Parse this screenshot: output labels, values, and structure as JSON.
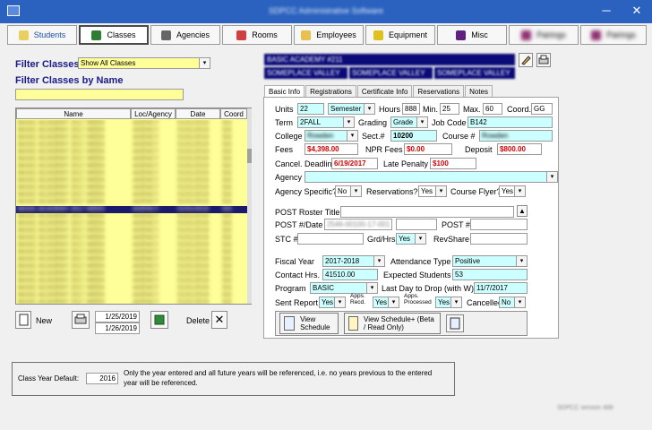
{
  "window": {
    "title": "SDPCC Administrative Software",
    "minimize": "─",
    "close": "✕"
  },
  "topnav": [
    {
      "label": "Students",
      "icon": "student-icon"
    },
    {
      "label": "Classes",
      "icon": "classes-icon"
    },
    {
      "label": "Agencies",
      "icon": "agencies-icon"
    },
    {
      "label": "Rooms",
      "icon": "rooms-icon"
    },
    {
      "label": "Employees",
      "icon": "employees-icon"
    },
    {
      "label": "Equipment",
      "icon": "equipment-icon"
    },
    {
      "label": "Misc",
      "icon": "misc-icon"
    },
    {
      "label": "Pairings",
      "icon": "pairings-icon"
    },
    {
      "label": "Pairings",
      "icon": "pairings-icon"
    }
  ],
  "filter": {
    "label": "Filter Classes",
    "value": "Show All Classes",
    "name_label": "Filter Classes by Name",
    "name_value": ""
  },
  "grid": {
    "columns": [
      "Name",
      "Loc/Agency",
      "Date",
      "Coord"
    ],
    "row_count": 26,
    "selected_row": 12,
    "blurred_name": "BASIC ACADEMY 2017 WEEK",
    "blurred_loc": "AGENCY",
    "blurred_date": "01/01/2019",
    "blurred_coord": "GG"
  },
  "list_actions": {
    "new": "New",
    "date_from": "1/25/2019",
    "date_to": "1/26/2019",
    "delete": "Delete"
  },
  "class_year": {
    "label": "Class Year Default:",
    "value": "2016",
    "note": "Only the year entered and all future years will be referenced, i.e. no years previous to the entered year will be referenced."
  },
  "header_fields": {
    "line1": "BASIC ACADEMY #211",
    "line2a": "SOMEPLACE VALLEY",
    "line2b": "SOMEPLACE VALLEY",
    "line2c": "SOMEPLACE VALLEY"
  },
  "tabs": [
    "Basic Info",
    "Registrations",
    "Certificate Info",
    "Reservations",
    "Notes"
  ],
  "basic": {
    "units_label": "Units",
    "units": "22",
    "units_type": "Semester",
    "hours_label": "Hours",
    "hours": "888",
    "min_label": "Min.",
    "min": "25",
    "max_label": "Max.",
    "max": "60",
    "coord_label": "Coord.",
    "coord": "GG",
    "term_label": "Term",
    "term": "2FALL",
    "grading_label": "Grading",
    "grading": "Grade",
    "job_code_label": "Job Code",
    "job_code": "B142",
    "college_label": "College",
    "college": "Rowden",
    "sect_label": "Sect.#",
    "sect": "10200",
    "course_label": "Course #",
    "course": "Rowden",
    "fees_label": "Fees",
    "fees": "$4,398.00",
    "npr_label": "NPR Fees",
    "npr": "$0.00",
    "deposit_label": "Deposit",
    "deposit": "$800.00",
    "cancel_label": "Cancel. Deadline",
    "cancel": "6/19/2017",
    "late_label": "Late Penalty",
    "late": "$100",
    "agency_label": "Agency",
    "agency": "",
    "agency_specific_label": "Agency Specific?",
    "agency_specific": "No",
    "reservations_label": "Reservations?",
    "reservations": "Yes",
    "flyer_label": "Course Flyer?",
    "flyer": "Yes",
    "post_title_label": "POST Roster Title",
    "post_title": "",
    "post_date_label": "POST #/Date",
    "post_date": "2546-00100-17-001",
    "post_num_label": "POST #",
    "post_num": "",
    "stc_label": "STC #",
    "stc": "",
    "grd_label": "Grd/Hrs",
    "grd": "Yes",
    "revshare_label": "RevShare",
    "revshare": "",
    "fiscal_label": "Fiscal Year",
    "fiscal": "2017-2018",
    "attendance_label": "Attendance Type",
    "attendance": "Positive",
    "contact_label": "Contact Hrs.",
    "contact": "41510.00",
    "expected_label": "Expected Students",
    "expected": "53",
    "program_label": "Program",
    "program": "BASIC",
    "lastday_label": "Last Day to Drop (with W)",
    "lastday": "11/7/2017",
    "sent_label": "Sent Report",
    "sent": "Yes",
    "apps_recd_label": "Apps. Recd.",
    "apps_recd": "Yes",
    "apps_proc_label": "Apps. Processed",
    "apps_proc": "Yes",
    "cancelled_label": "Cancelled",
    "cancelled": "No"
  },
  "schedule": {
    "view": "View Schedule",
    "view_plus": "View Schedule+ (Beta / Read Only)"
  },
  "footer": {
    "version": "SDPCC version 488"
  }
}
